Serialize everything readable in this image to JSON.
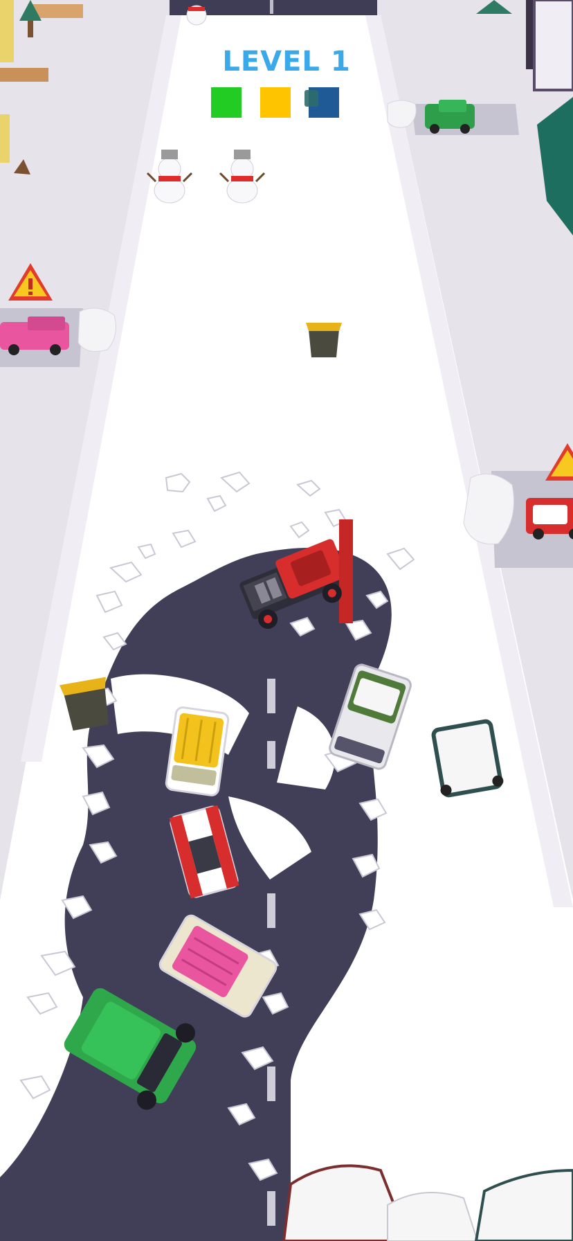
{
  "hud": {
    "level_label": "LEVEL 1"
  },
  "progress": {
    "targets": [
      {
        "color": "#22cc22",
        "state": "filled"
      },
      {
        "color": "#ffc400",
        "state": "filled"
      },
      {
        "color": "#1f5a96",
        "state": "filled"
      }
    ]
  },
  "palette": {
    "snow": "#ffffff",
    "sidewalk": "#e6e3eb",
    "road": "#413f58",
    "plow_truck": "#d82d2d"
  },
  "scene_objects": {
    "cars_in_queue": [
      "green",
      "pink",
      "red-white",
      "yellow",
      "olive-white"
    ],
    "obstacles": [
      "trash-bin",
      "trash-bin",
      "snowman",
      "snowman",
      "warning-sign",
      "warning-sign"
    ]
  }
}
